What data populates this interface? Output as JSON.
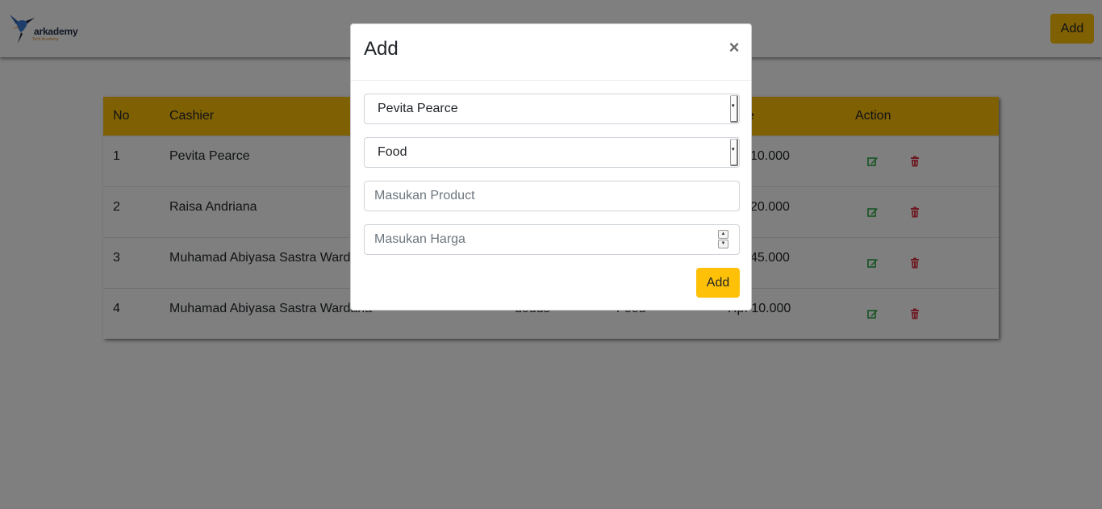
{
  "header": {
    "logo_text": "arkademy",
    "logo_sub": "Tech Academy",
    "add_label": "Add"
  },
  "table": {
    "columns": [
      "No",
      "Cashier",
      "",
      "",
      "e",
      "Action"
    ],
    "rows": [
      {
        "no": "1",
        "cashier": "Pevita Pearce",
        "col3": "",
        "col4": "",
        "price": "10.000"
      },
      {
        "no": "2",
        "cashier": "Raisa Andriana",
        "col3": "",
        "col4": "",
        "price": "20.000"
      },
      {
        "no": "3",
        "cashier": "Muhamad Abiyasa Sastra Ward",
        "col3": "",
        "col4": "",
        "price": "45.000"
      },
      {
        "no": "4",
        "cashier": "Muhamad Abiyasa Sastra Wardana",
        "col3": "dodds",
        "col4": "Food",
        "price": "Rp. 10.000"
      }
    ]
  },
  "modal": {
    "title": "Add",
    "close": "×",
    "cashier_select": "Pevita Pearce",
    "category_select": "Food",
    "product_placeholder": "Masukan Product",
    "price_placeholder": "Masukan Harga",
    "submit_label": "Add"
  },
  "colors": {
    "accent": "#ffc107",
    "edit": "#28a745",
    "delete": "#dc3545"
  }
}
